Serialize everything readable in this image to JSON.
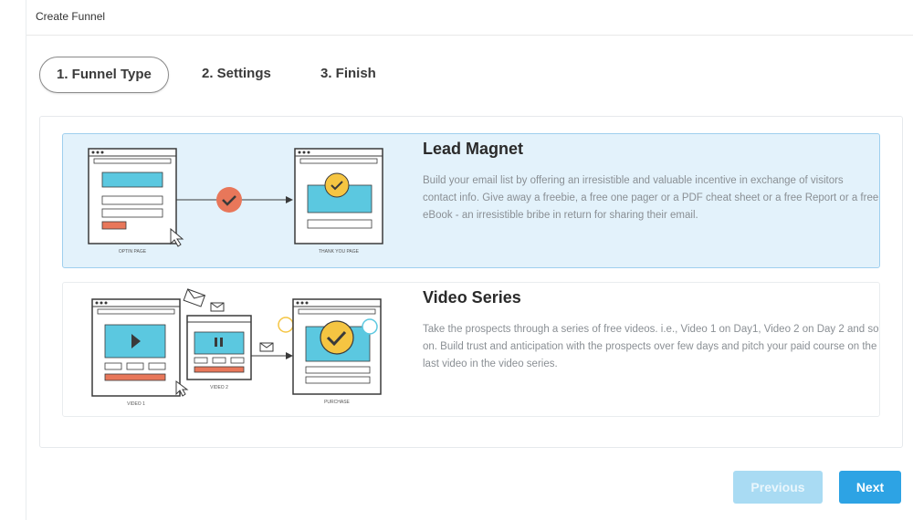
{
  "modal": {
    "title": "Create Funnel"
  },
  "steps": [
    {
      "label": "1. Funnel Type",
      "active": true
    },
    {
      "label": "2. Settings",
      "active": false
    },
    {
      "label": "3. Finish",
      "active": false
    }
  ],
  "funnels": [
    {
      "title": "Lead Magnet",
      "description": "Build your email list by offering an irresistible and valuable incentive in exchange of visitors contact info. Give away a freebie, a free one pager or a PDF cheat sheet or a free Report or a free eBook - an irresistible bribe in return for sharing their email.",
      "illustration": {
        "left_caption": "OPTIN PAGE",
        "right_caption": "THANK YOU PAGE"
      },
      "selected": true
    },
    {
      "title": "Video Series",
      "description": "Take the prospects through a series of free videos. i.e., Video 1 on Day1, Video 2 on Day 2 and so on. Build trust and anticipation with the prospects over few days and pitch your paid course on the last video in the video series.",
      "illustration": {
        "left_caption": "VIDEO 1",
        "middle_caption": "VIDEO 2",
        "right_caption": "PURCHASE"
      },
      "selected": false
    }
  ],
  "buttons": {
    "previous": "Previous",
    "next": "Next"
  },
  "colors": {
    "accent": "#2da3e4",
    "selected_bg": "#e3f2fb",
    "illus_blue": "#5bc8e0",
    "illus_red": "#e8775a",
    "illus_yellow": "#f5c542"
  }
}
